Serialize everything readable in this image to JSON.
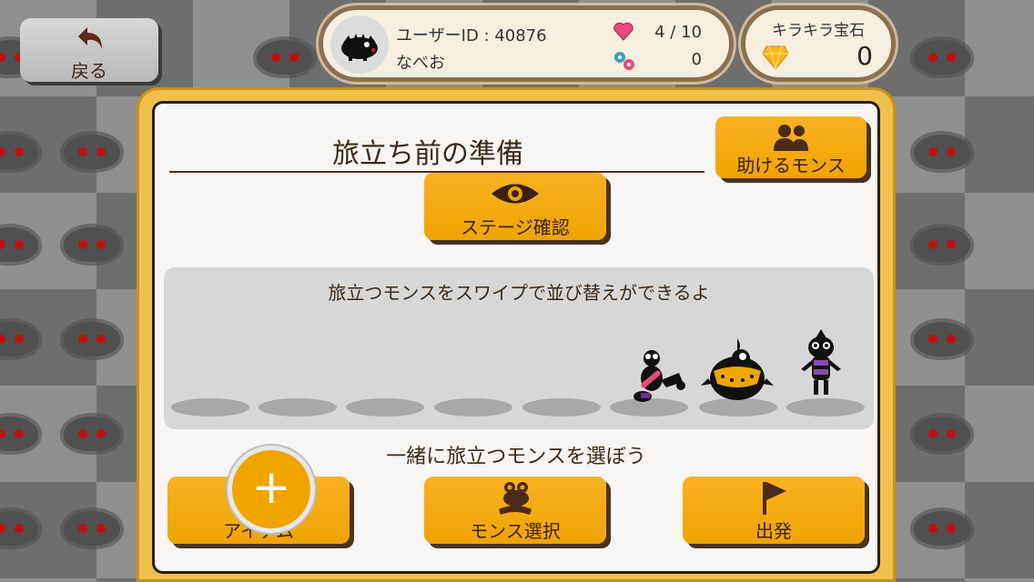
{
  "header": {
    "back_label": "戻る",
    "user_id": "ユーザーID : 40876",
    "user_name": "なべお",
    "hearts": "4 / 10",
    "candy": "0",
    "gem_title": "キラキラ宝石",
    "gem_count": "0"
  },
  "panel": {
    "title": "旅立ち前の準備",
    "helper_label": "助けるモンス",
    "stage_label": "ステージ確認",
    "swipe_hint": "旅立つモンスをスワイプで並び替えができるよ",
    "select_hint": "一緒に旅立つモンスを選ぼう",
    "item_label": "アイテム",
    "plus_symbol": "+",
    "mons_select_label": "モンス選択",
    "depart_label": "出発"
  },
  "icons": {
    "back": "back-arrow-icon",
    "heart": "heart-icon",
    "candy": "candy-icon",
    "gem": "gem-icon",
    "helper": "people-icon",
    "stage": "eye-icon",
    "mons_select": "monster-icon",
    "depart": "flag-icon"
  },
  "colors": {
    "accent": "#f0a400",
    "panel_border": "#f0c14a",
    "heart": "#e84a7a"
  }
}
